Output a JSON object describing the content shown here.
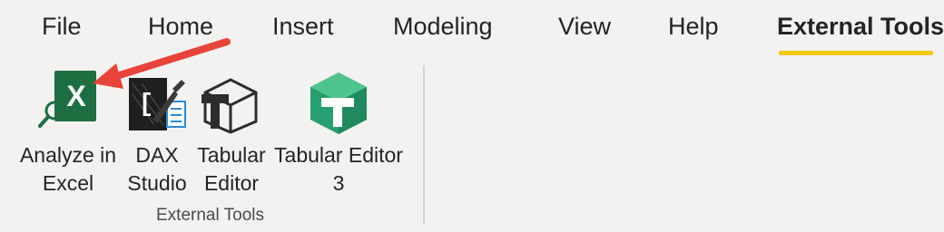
{
  "tabs": [
    {
      "label": "File"
    },
    {
      "label": "Home"
    },
    {
      "label": "Insert"
    },
    {
      "label": "Modeling"
    },
    {
      "label": "View"
    },
    {
      "label": "Help"
    },
    {
      "label": "External Tools",
      "active": true
    }
  ],
  "ribbon": {
    "group_label": "External Tools",
    "tools": [
      {
        "label": "Analyze in\nExcel",
        "icon": "excel-analyze-icon"
      },
      {
        "label": "DAX\nStudio",
        "icon": "dax-studio-icon"
      },
      {
        "label": "Tabular\nEditor",
        "icon": "tabular-editor-icon"
      },
      {
        "label": "Tabular Editor\n3",
        "icon": "tabular-editor-3-icon"
      }
    ]
  },
  "colors": {
    "active_underline": "#f2c811",
    "annotation_arrow": "#e8443a",
    "excel_green": "#1d6f42",
    "te3_green": "#27a06f"
  }
}
